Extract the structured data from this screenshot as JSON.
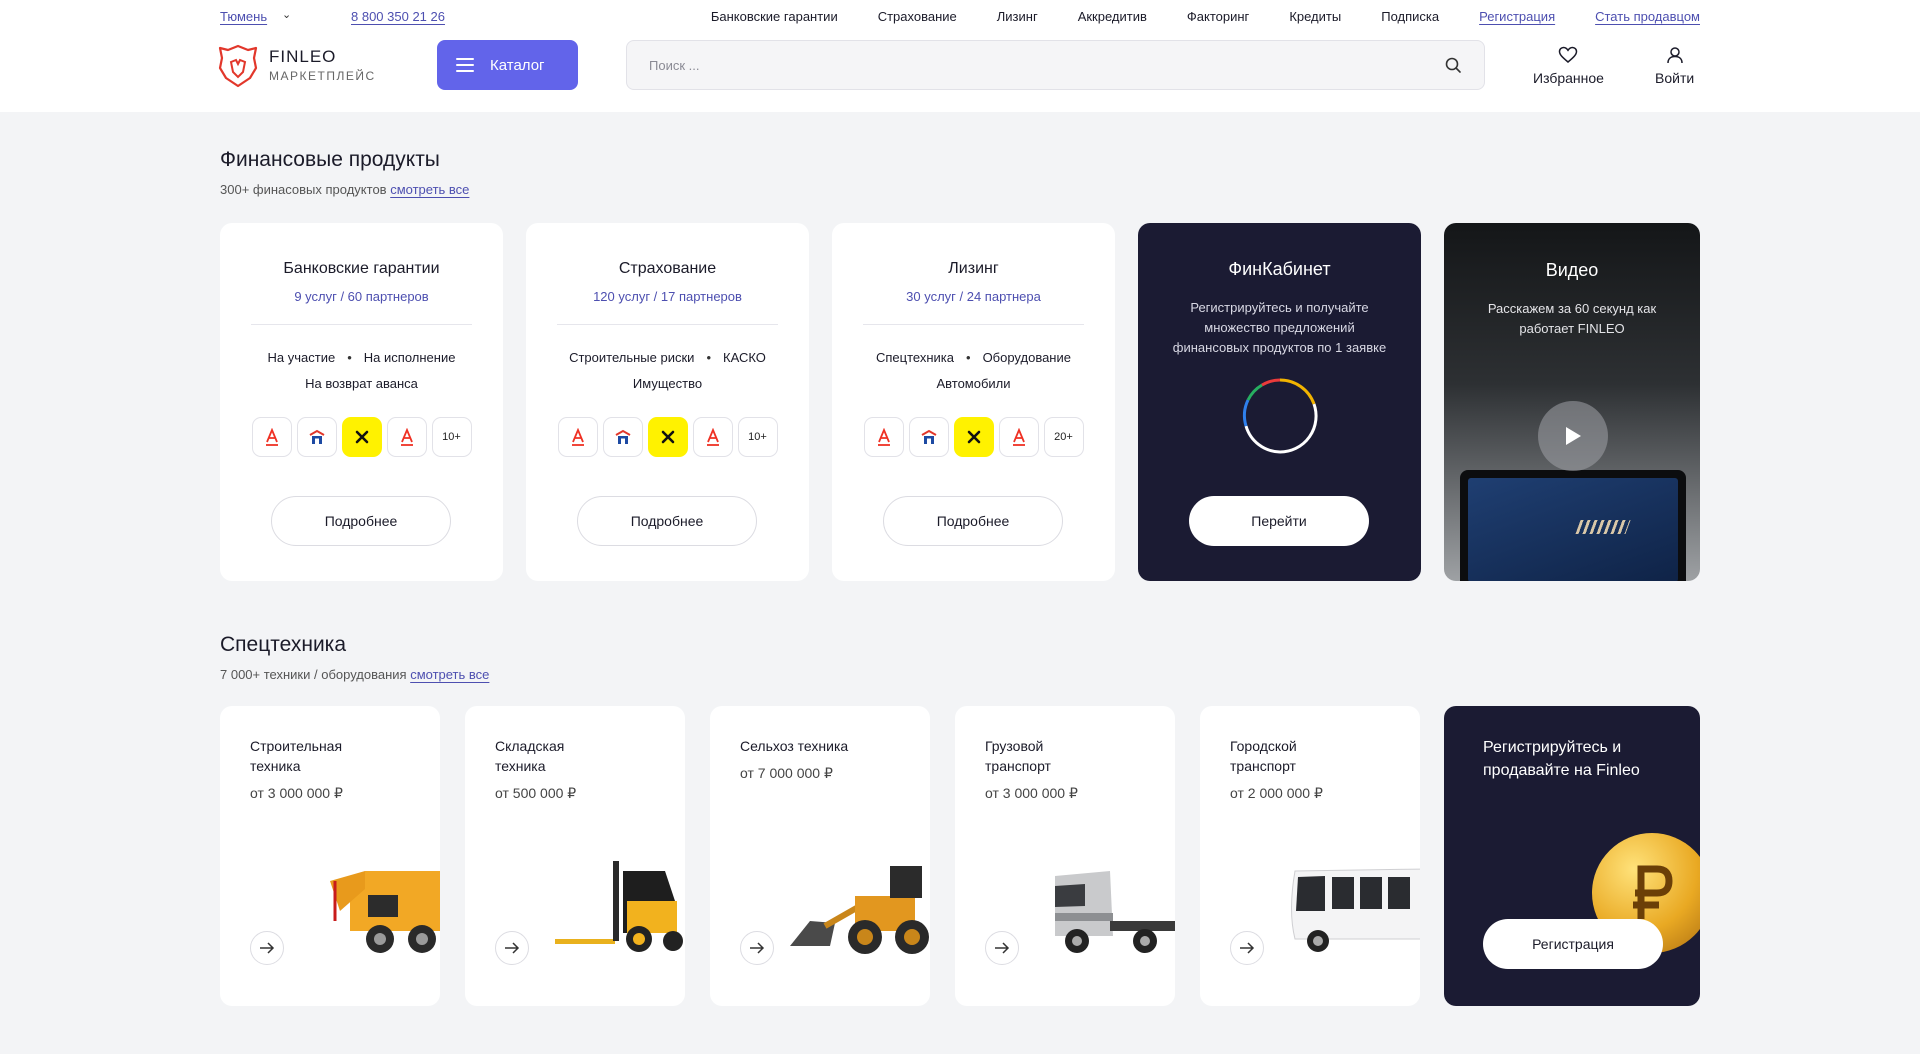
{
  "header": {
    "city": "Тюмень",
    "phone": "8 800 350 21 26",
    "nav": [
      "Банковские гарантии",
      "Страхование",
      "Лизинг",
      "Аккредитив",
      "Факторинг",
      "Кредиты",
      "Подписка"
    ],
    "register_link": "Регистрация",
    "seller_link": "Стать продавцом",
    "brand": "FINLEO",
    "brand_sub": "МАРКЕТПЛЕЙС",
    "catalog": "Каталог",
    "search_placeholder": "Поиск ...",
    "favorites": "Избранное",
    "login": "Войти",
    "accent": "#6264ea"
  },
  "finance": {
    "title": "Финансовые продукты",
    "subtitle": "300+ финасовых продуктов",
    "see_all": "смотреть все",
    "cards": [
      {
        "title": "Банковские гарантии",
        "stats": "9 услуг / 60 партнеров",
        "tag1": "На участие",
        "tag2": "На исполнение",
        "tag3": "На возврат аванса",
        "more_count": "10+",
        "button": "Подробнее"
      },
      {
        "title": "Страхование",
        "stats": "120 услуг / 17 партнеров",
        "tag1": "Строительные риски",
        "tag2": "КАСКО",
        "tag3": "Имущество",
        "more_count": "10+",
        "button": "Подробнее"
      },
      {
        "title": "Лизинг",
        "stats": "30 услуг / 24 партнера",
        "tag1": "Спецтехника",
        "tag2": "Оборудование",
        "tag3": "Автомобили",
        "more_count": "20+",
        "button": "Подробнее"
      }
    ],
    "fincabinet": {
      "title": "ФинКабинет",
      "text": "Регистрируйтесь и получайте множество предложений финансовых продуктов по 1 заявке",
      "button": "Перейти"
    },
    "video": {
      "title": "Видео",
      "text": "Расскажем за 60 секунд как работает FINLEO"
    }
  },
  "equipment": {
    "title": "Спецтехника",
    "subtitle": "7 000+ техники / оборудования",
    "see_all": "смотреть все",
    "cards": [
      {
        "title": "Строительная техника",
        "price": "от 3 000 000 ₽"
      },
      {
        "title": "Складская техника",
        "price": "от 500 000 ₽"
      },
      {
        "title": "Сельхоз техника",
        "price": "от 7 000 000 ₽"
      },
      {
        "title": "Грузовой транспорт",
        "price": "от 3 000 000 ₽"
      },
      {
        "title": "Городской транспорт",
        "price": "от 2 000 000 ₽"
      }
    ],
    "register_card": {
      "title": "Регистрируйтесь и продавайте на Finleo",
      "button": "Регистрация"
    }
  }
}
